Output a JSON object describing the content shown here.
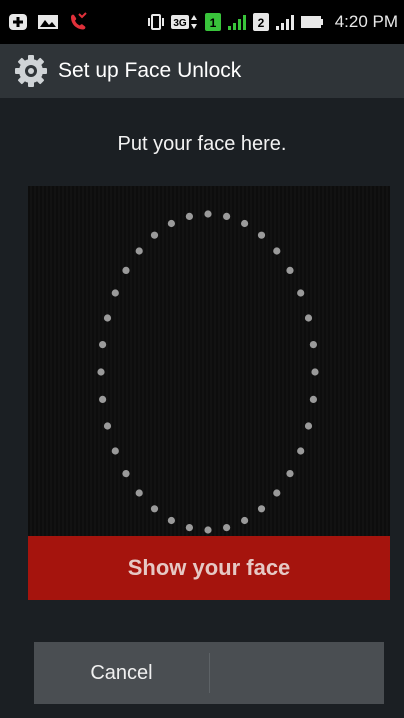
{
  "status_bar": {
    "time": "4:20 PM",
    "sim1": "1",
    "sim2": "2",
    "network": "3G",
    "icons": [
      "plus-box-icon",
      "image-icon",
      "missed-call-icon",
      "vibrate-icon",
      "network-3g-icon",
      "sim1-icon",
      "signal-icon",
      "sim2-icon",
      "signal-icon",
      "battery-icon"
    ]
  },
  "action_bar": {
    "title": "Set up Face Unlock",
    "icon": "gear-icon"
  },
  "main": {
    "instruction": "Put your face here.",
    "primary_action": "Show your face"
  },
  "buttons": {
    "cancel": "Cancel"
  },
  "colors": {
    "accent_red": "#a5140d",
    "sim_green": "#39c43b",
    "missed_call": "#e0303a"
  }
}
